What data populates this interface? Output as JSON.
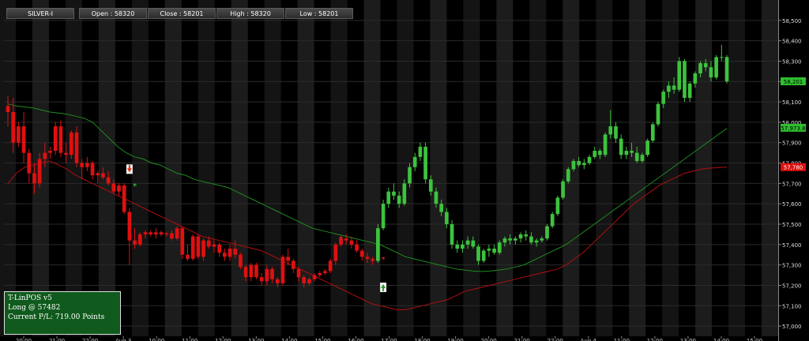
{
  "header": {
    "symbol": "SILVER-I",
    "open": "Open : 58320",
    "close": "Close : 58201",
    "high": "High : 58320",
    "low": "Low : 58201"
  },
  "info_box": {
    "title": "T-LinPOS v5",
    "position": "Long @ 57482",
    "pl": "Current P/L: 719.00 Points"
  },
  "colors": {
    "up": "#3ec23e",
    "down": "#e01010",
    "upper_band": "#1f8a1f",
    "lower_band": "#b01010",
    "background": "#000000",
    "stripe": "#1c1c1c",
    "last_price_bg": "#2fbf2f",
    "upper_tag_bg": "#2fbf2f",
    "lower_tag_bg": "#e01010"
  },
  "chart_data": {
    "type": "candlestick",
    "y_range": [
      56950,
      58600
    ],
    "y_ticks": [
      57000,
      57100,
      57200,
      57300,
      57400,
      57500,
      57600,
      57700,
      57800,
      57900,
      58000,
      58100,
      58200,
      58300,
      58400,
      58500
    ],
    "y_tick_labels": [
      "57,000",
      "57,100",
      "57,200",
      "57,300",
      "57,400",
      "57,500",
      "57,600",
      "57,700",
      "57,800",
      "57,900",
      "58,000",
      "58,100",
      "58,200",
      "58,300",
      "58,400",
      "58,500"
    ],
    "x_labels": [
      "20:00",
      "21:00",
      "22:00",
      "Aug 3",
      "10:00",
      "11:00",
      "12:00",
      "13:00",
      "14:00",
      "15:00",
      "16:00",
      "17:00",
      "18:00",
      "19:00",
      "20:00",
      "21:00",
      "22:00",
      "Aug 4",
      "11:00",
      "12:00",
      "13:00",
      "14:00",
      "15:00"
    ],
    "bar_count": 178,
    "price_tags": {
      "last": {
        "value": 58201,
        "label": "58,201"
      },
      "upper_band": {
        "value": 57973,
        "label": "57,973.8"
      },
      "lower_band": {
        "value": 57780,
        "label": "57,780"
      }
    },
    "candles": [
      [
        58080,
        58130,
        57980,
        58050
      ],
      [
        58050,
        58120,
        57850,
        57900
      ],
      [
        57900,
        58000,
        57880,
        57980
      ],
      [
        57980,
        58050,
        57800,
        57850
      ],
      [
        57850,
        57870,
        57700,
        57750
      ],
      [
        57750,
        57800,
        57650,
        57700
      ],
      [
        57700,
        57850,
        57680,
        57820
      ],
      [
        57820,
        57900,
        57780,
        57850
      ],
      [
        57850,
        57880,
        57820,
        57860
      ],
      [
        57860,
        58000,
        57840,
        57980
      ],
      [
        57980,
        58010,
        57830,
        57850
      ],
      [
        57850,
        57900,
        57800,
        57840
      ],
      [
        57840,
        57960,
        57820,
        57950
      ],
      [
        57950,
        57980,
        57780,
        57800
      ],
      [
        57800,
        57820,
        57720,
        57780
      ],
      [
        57780,
        57830,
        57760,
        57800
      ],
      [
        57800,
        57810,
        57720,
        57740
      ],
      [
        57740,
        57760,
        57700,
        57750
      ],
      [
        57750,
        57780,
        57720,
        57730
      ],
      [
        57730,
        57760,
        57690,
        57700
      ],
      [
        57700,
        57720,
        57650,
        57660
      ],
      [
        57660,
        57700,
        57640,
        57690
      ],
      [
        57690,
        57700,
        57550,
        57560
      ],
      [
        57560,
        57580,
        57300,
        57420
      ],
      [
        57420,
        57480,
        57380,
        57400
      ],
      [
        57400,
        57460,
        57390,
        57450
      ],
      [
        57450,
        57470,
        57430,
        57460
      ],
      [
        57460,
        57470,
        57440,
        57450
      ],
      [
        57450,
        57480,
        57430,
        57460
      ],
      [
        57460,
        57470,
        57440,
        57450
      ],
      [
        57450,
        57460,
        57440,
        57455
      ],
      [
        57455,
        57470,
        57420,
        57430
      ],
      [
        57430,
        57490,
        57420,
        57480
      ],
      [
        57480,
        57490,
        57330,
        57350
      ],
      [
        57350,
        57400,
        57320,
        57330
      ],
      [
        57330,
        57450,
        57320,
        57440
      ],
      [
        57440,
        57450,
        57330,
        57340
      ],
      [
        57340,
        57430,
        57320,
        57420
      ],
      [
        57420,
        57440,
        57380,
        57390
      ],
      [
        57390,
        57420,
        57360,
        57400
      ],
      [
        57400,
        57410,
        57340,
        57360
      ],
      [
        57360,
        57380,
        57320,
        57340
      ],
      [
        57340,
        57400,
        57320,
        57380
      ],
      [
        57380,
        57420,
        57330,
        57350
      ],
      [
        57350,
        57360,
        57280,
        57290
      ],
      [
        57290,
        57300,
        57220,
        57240
      ],
      [
        57240,
        57310,
        57220,
        57300
      ],
      [
        57300,
        57310,
        57230,
        57240
      ],
      [
        57240,
        57260,
        57200,
        57220
      ],
      [
        57220,
        57300,
        57200,
        57280
      ],
      [
        57280,
        57290,
        57210,
        57230
      ],
      [
        57230,
        57240,
        57190,
        57210
      ],
      [
        57210,
        57350,
        57200,
        57340
      ],
      [
        57340,
        57380,
        57300,
        57320
      ],
      [
        57320,
        57330,
        57260,
        57280
      ],
      [
        57280,
        57290,
        57220,
        57240
      ],
      [
        57240,
        57250,
        57190,
        57210
      ],
      [
        57210,
        57240,
        57200,
        57230
      ],
      [
        57230,
        57260,
        57220,
        57250
      ],
      [
        57250,
        57270,
        57240,
        57260
      ],
      [
        57260,
        57280,
        57250,
        57270
      ],
      [
        57270,
        57330,
        57260,
        57320
      ],
      [
        57320,
        57410,
        57300,
        57400
      ],
      [
        57400,
        57440,
        57390,
        57430
      ],
      [
        57430,
        57450,
        57400,
        57420
      ],
      [
        57420,
        57440,
        57380,
        57400
      ],
      [
        57400,
        57420,
        57360,
        57370
      ],
      [
        57370,
        57380,
        57320,
        57340
      ],
      [
        57340,
        57360,
        57310,
        57330
      ],
      [
        57330,
        57340,
        57300,
        57320
      ],
      [
        57320,
        57500,
        57310,
        57480
      ],
      [
        57480,
        57620,
        57470,
        57600
      ],
      [
        57600,
        57680,
        57580,
        57660
      ],
      [
        57660,
        57700,
        57620,
        57640
      ],
      [
        57640,
        57660,
        57580,
        57600
      ],
      [
        57600,
        57720,
        57590,
        57700
      ],
      [
        57700,
        57800,
        57680,
        57780
      ],
      [
        57780,
        57850,
        57760,
        57830
      ],
      [
        57830,
        57900,
        57810,
        57880
      ],
      [
        57880,
        57900,
        57700,
        57720
      ],
      [
        57720,
        57740,
        57640,
        57660
      ],
      [
        57660,
        57680,
        57580,
        57600
      ],
      [
        57600,
        57620,
        57540,
        57560
      ],
      [
        57560,
        57580,
        57480,
        57500
      ],
      [
        57500,
        57520,
        57380,
        57400
      ],
      [
        57400,
        57420,
        57360,
        57380
      ],
      [
        57380,
        57420,
        57360,
        57400
      ],
      [
        57400,
        57440,
        57380,
        57420
      ],
      [
        57420,
        57440,
        57380,
        57390
      ],
      [
        57390,
        57400,
        57300,
        57320
      ],
      [
        57320,
        57380,
        57310,
        57370
      ],
      [
        57370,
        57400,
        57340,
        57380
      ],
      [
        57380,
        57400,
        57350,
        57360
      ],
      [
        57360,
        57420,
        57350,
        57410
      ],
      [
        57410,
        57440,
        57390,
        57430
      ],
      [
        57430,
        57450,
        57400,
        57420
      ],
      [
        57420,
        57440,
        57400,
        57430
      ],
      [
        57430,
        57460,
        57410,
        57450
      ],
      [
        57450,
        57470,
        57420,
        57440
      ],
      [
        57440,
        57460,
        57400,
        57410
      ],
      [
        57410,
        57430,
        57390,
        57420
      ],
      [
        57420,
        57440,
        57410,
        57430
      ],
      [
        57430,
        57500,
        57420,
        57490
      ],
      [
        57490,
        57560,
        57480,
        57550
      ],
      [
        57550,
        57640,
        57540,
        57630
      ],
      [
        57630,
        57720,
        57620,
        57710
      ],
      [
        57710,
        57780,
        57700,
        57770
      ],
      [
        57770,
        57820,
        57760,
        57810
      ],
      [
        57810,
        57830,
        57780,
        57790
      ],
      [
        57790,
        57820,
        57770,
        57800
      ],
      [
        57800,
        57840,
        57790,
        57830
      ],
      [
        57830,
        57880,
        57820,
        57860
      ],
      [
        57860,
        57870,
        57820,
        57840
      ],
      [
        57840,
        57950,
        57830,
        57940
      ],
      [
        57940,
        58060,
        57920,
        57980
      ],
      [
        57980,
        58000,
        57900,
        57920
      ],
      [
        57920,
        57940,
        57820,
        57840
      ],
      [
        57840,
        57880,
        57820,
        57860
      ],
      [
        57860,
        57900,
        57830,
        57850
      ],
      [
        57850,
        57880,
        57800,
        57810
      ],
      [
        57810,
        57850,
        57800,
        57840
      ],
      [
        57840,
        57920,
        57830,
        57910
      ],
      [
        57910,
        58000,
        57900,
        57990
      ],
      [
        57990,
        58100,
        57980,
        58090
      ],
      [
        58090,
        58160,
        58070,
        58150
      ],
      [
        58150,
        58200,
        58120,
        58180
      ],
      [
        58180,
        58220,
        58140,
        58160
      ],
      [
        58160,
        58320,
        58150,
        58300
      ],
      [
        58300,
        58310,
        58100,
        58120
      ],
      [
        58120,
        58200,
        58100,
        58190
      ],
      [
        58190,
        58250,
        58170,
        58240
      ],
      [
        58240,
        58300,
        58220,
        58290
      ],
      [
        58290,
        58310,
        58250,
        58270
      ],
      [
        58270,
        58300,
        58200,
        58220
      ],
      [
        58220,
        58330,
        58210,
        58320
      ],
      [
        58320,
        58380,
        58300,
        58320
      ],
      [
        58320,
        58330,
        58190,
        58201
      ]
    ],
    "upper_band": [
      58090,
      58080,
      58075,
      58070,
      58060,
      58050,
      58045,
      58040,
      58030,
      58020,
      58000,
      57960,
      57920,
      57880,
      57850,
      57830,
      57820,
      57800,
      57790,
      57770,
      57750,
      57740,
      57720,
      57710,
      57700,
      57690,
      57680,
      57660,
      57640,
      57620,
      57600,
      57580,
      57560,
      57540,
      57520,
      57500,
      57480,
      57470,
      57460,
      57450,
      57440,
      57430,
      57420,
      57410,
      57400,
      57380,
      57360,
      57340,
      57330,
      57320,
      57310,
      57300,
      57290,
      57280,
      57275,
      57270,
      57268,
      57270,
      57275,
      57280,
      57290,
      57300,
      57320,
      57340,
      57360,
      57380,
      57400,
      57430,
      57460,
      57490,
      57520,
      57550,
      57580,
      57610,
      57640,
      57670,
      57700,
      57730,
      57760,
      57790,
      57820,
      57850,
      57880,
      57910,
      57940,
      57970
    ],
    "lower_band": [
      57700,
      57750,
      57780,
      57790,
      57800,
      57810,
      57790,
      57770,
      57740,
      57720,
      57700,
      57680,
      57660,
      57640,
      57620,
      57600,
      57580,
      57560,
      57540,
      57520,
      57500,
      57480,
      57460,
      57440,
      57430,
      57420,
      57410,
      57400,
      57390,
      57380,
      57370,
      57350,
      57330,
      57310,
      57290,
      57270,
      57250,
      57230,
      57210,
      57190,
      57170,
      57150,
      57130,
      57110,
      57100,
      57090,
      57080,
      57080,
      57090,
      57100,
      57110,
      57120,
      57130,
      57150,
      57170,
      57180,
      57190,
      57200,
      57210,
      57220,
      57230,
      57240,
      57250,
      57260,
      57270,
      57280,
      57300,
      57330,
      57360,
      57400,
      57440,
      57480,
      57520,
      57560,
      57600,
      57630,
      57660,
      57690,
      57710,
      57730,
      57750,
      57760,
      57770,
      57775,
      57778,
      57780
    ],
    "signals": [
      {
        "bar": 23,
        "type": "sell-arrow",
        "price": 57770
      },
      {
        "bar": 24,
        "type": "star-green",
        "price": 57690
      },
      {
        "bar": 63,
        "type": "star-red",
        "price": 57430
      },
      {
        "bar": 71,
        "type": "star-red",
        "price": 57330
      },
      {
        "bar": 71,
        "type": "buy-arrow",
        "price": 57190
      }
    ]
  }
}
